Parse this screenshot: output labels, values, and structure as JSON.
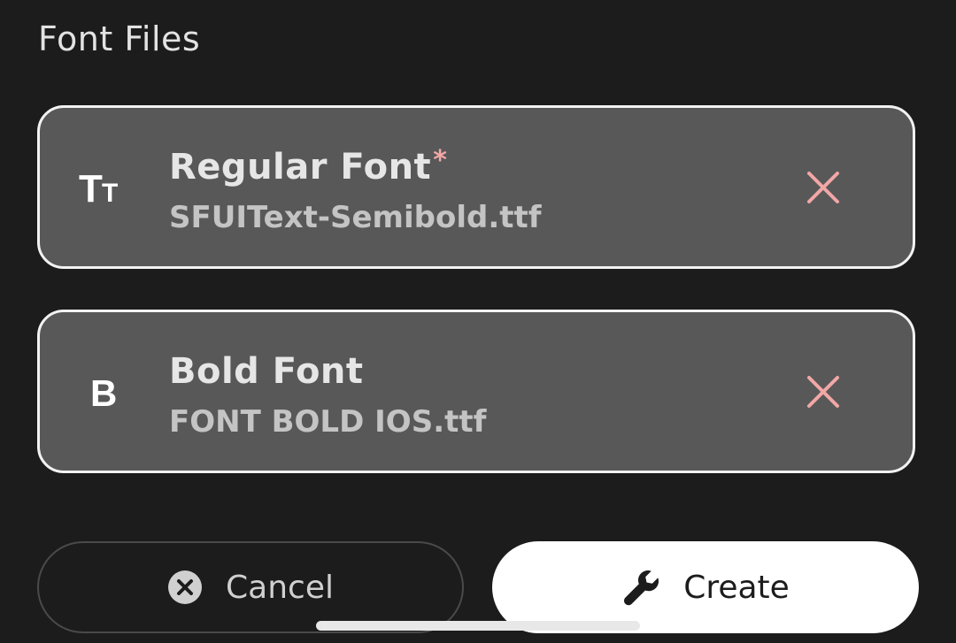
{
  "section": {
    "title": "Font Files"
  },
  "fonts": [
    {
      "label": "Regular Font",
      "required_mark": "*",
      "filename": "SFUIText-Semibold.ttf",
      "icon": "text-size-icon"
    },
    {
      "label": "Bold Font",
      "filename": "FONT BOLD IOS.ttf",
      "icon": "bold-icon"
    }
  ],
  "actions": {
    "cancel_label": "Cancel",
    "create_label": "Create"
  },
  "colors": {
    "background": "#1c1c1c",
    "card": "#585858",
    "card_border": "#f2f2f2",
    "remove_icon": "#f2a7a7",
    "required_mark": "#f2a7a7",
    "create_button": "#ffffff"
  }
}
